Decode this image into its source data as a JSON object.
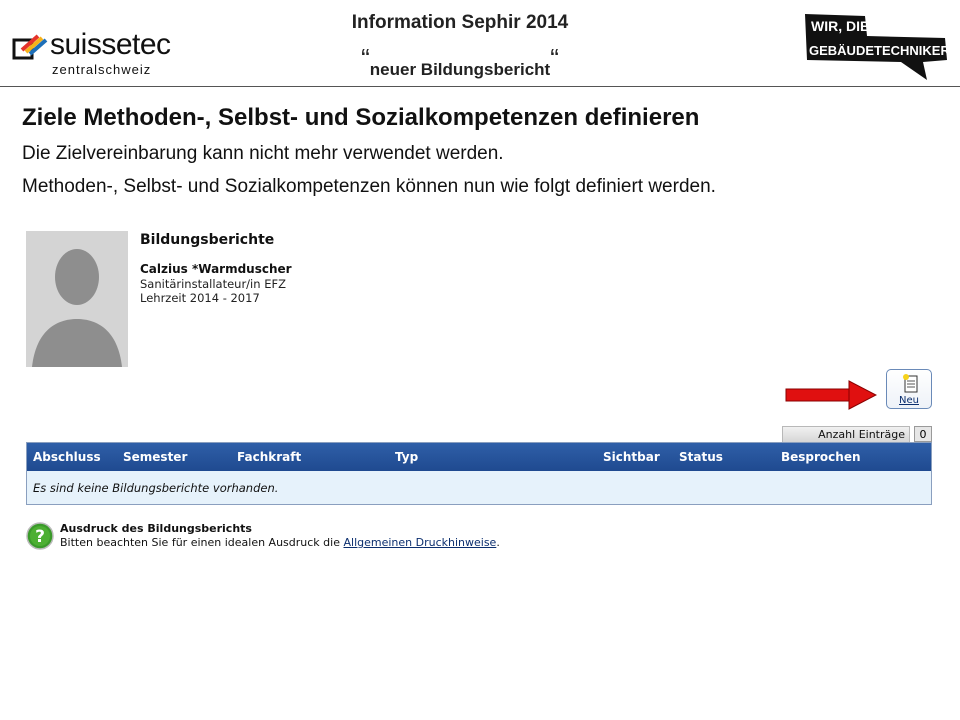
{
  "header": {
    "brand": "suissetec",
    "brand_sub": "zentralschweiz",
    "title_line1": "Information Sephir 2014",
    "title_line2": "neuer Bildungsbericht",
    "quote_open": "“",
    "quote_close": "“",
    "right_logo_line1": "WIR, DIE",
    "right_logo_line2": "GEBÄUDETECHNIKER."
  },
  "slide": {
    "heading": "Ziele Methoden-, Selbst- und Sozialkompetenzen definieren",
    "line1": "Die Zielvereinbarung kann nicht mehr verwendet werden.",
    "line2": "Methoden-, Selbst- und Sozialkompetenzen können nun wie folgt definiert werden."
  },
  "app": {
    "profile": {
      "title": "Bildungsberichte",
      "name": "Calzius *Warmduscher",
      "profession": "Sanitärinstallateur/in EFZ",
      "period": "Lehrzeit 2014 - 2017"
    },
    "new_button": {
      "label": "Neu",
      "icon": "new-document-icon"
    },
    "count": {
      "label": "Anzahl Einträge",
      "value": "0"
    },
    "table": {
      "columns": [
        "Abschluss",
        "Semester",
        "Fachkraft",
        "Typ",
        "Sichtbar",
        "Status",
        "Besprochen"
      ],
      "empty_message": "Es sind keine Bildungsberichte vorhanden."
    },
    "print": {
      "icon": "help-icon",
      "title": "Ausdruck des Bildungsberichts",
      "text_before": "Bitten beachten Sie für einen idealen Ausdruck die ",
      "link": "Allgemeinen Druckhinweise",
      "text_after": "."
    }
  },
  "colors": {
    "table_header": "#1f4a90",
    "table_body": "#e6f2fb",
    "arrow": "#e01010",
    "help_green": "#3a9a2a"
  }
}
